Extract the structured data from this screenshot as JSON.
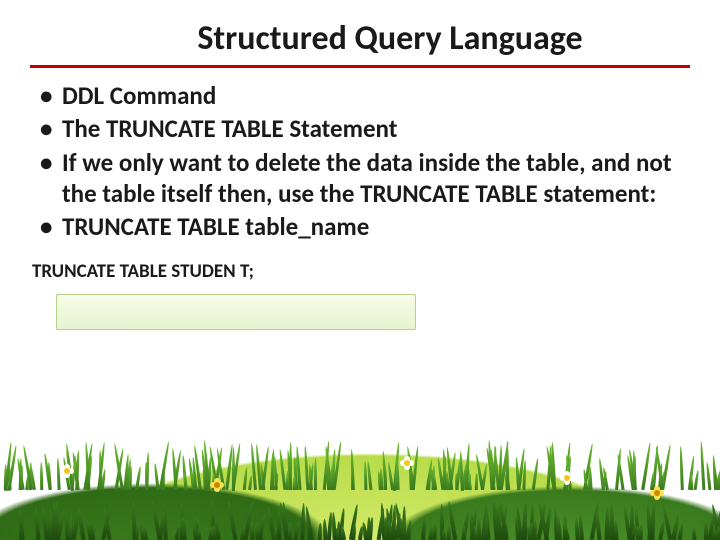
{
  "title": "Structured Query Language",
  "bullets": [
    "DDL  Command",
    "The TRUNCATE TABLE Statement",
    "If we only want to delete the data inside the table, and not the table itself then, use the TRUNCATE TABLE statement:",
    "TRUNCATE TABLE table_name"
  ],
  "code": "TRUNCATE TABLE STUDEN T;"
}
